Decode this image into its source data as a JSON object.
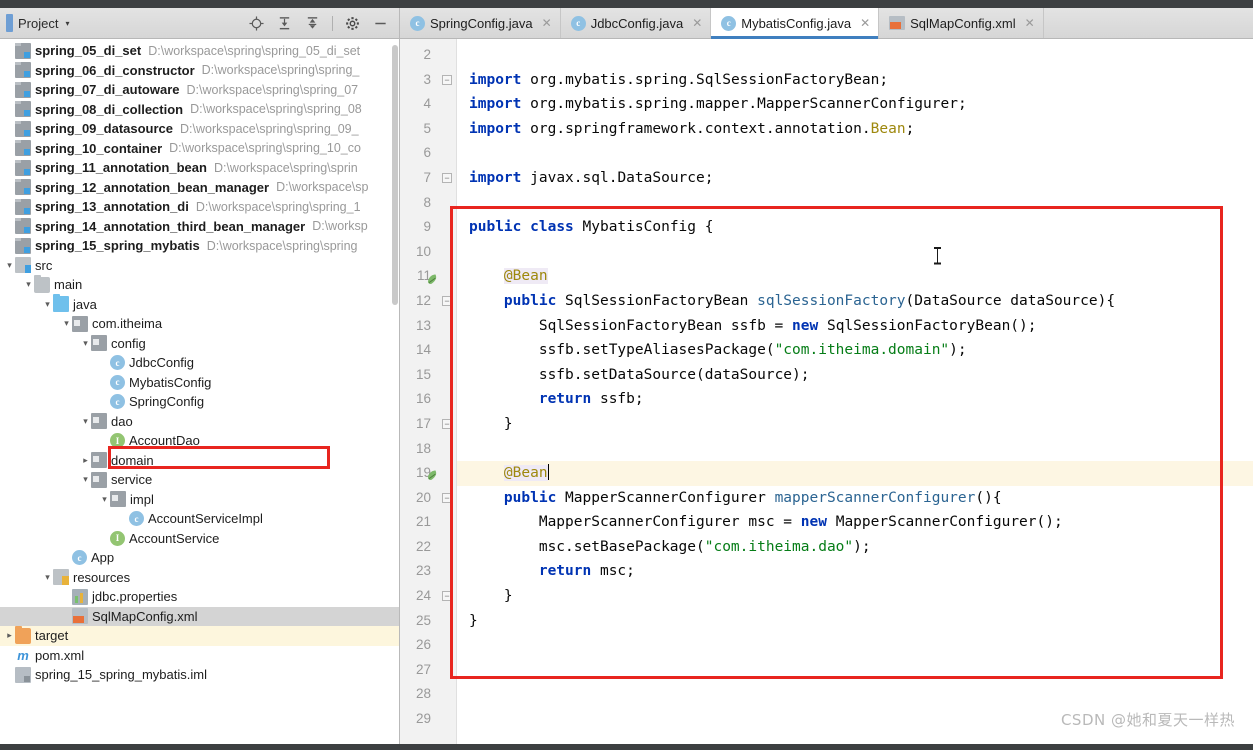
{
  "window": {
    "watermark": "CSDN @她和夏天一样热"
  },
  "project_panel": {
    "title": "Project",
    "caret": "▾",
    "tools": [
      {
        "name": "locate-icon",
        "glyph": "⊕"
      },
      {
        "name": "expand-all-icon",
        "glyph": "⇟"
      },
      {
        "name": "collapse-all-icon",
        "glyph": "⇞"
      },
      {
        "name": "settings-gear-icon",
        "glyph": "✿"
      },
      {
        "name": "hide-icon",
        "glyph": "—"
      }
    ],
    "modules": [
      {
        "name": "spring_05_di_set",
        "path": "D:\\workspace\\spring\\spring_05_di_set"
      },
      {
        "name": "spring_06_di_constructor",
        "path": "D:\\workspace\\spring\\spring_"
      },
      {
        "name": "spring_07_di_autoware",
        "path": "D:\\workspace\\spring\\spring_07"
      },
      {
        "name": "spring_08_di_collection",
        "path": "D:\\workspace\\spring\\spring_08"
      },
      {
        "name": "spring_09_datasource",
        "path": "D:\\workspace\\spring\\spring_09_"
      },
      {
        "name": "spring_10_container",
        "path": "D:\\workspace\\spring\\spring_10_co"
      },
      {
        "name": "spring_11_annotation_bean",
        "path": "D:\\workspace\\spring\\sprin"
      },
      {
        "name": "spring_12_annotation_bean_manager",
        "path": "D:\\workspace\\sp"
      },
      {
        "name": "spring_13_annotation_di",
        "path": "D:\\workspace\\spring\\spring_1"
      },
      {
        "name": "spring_14_annotation_third_bean_manager",
        "path": "D:\\worksp"
      },
      {
        "name": "spring_15_spring_mybatis",
        "path": "D:\\workspace\\spring\\spring"
      }
    ],
    "tree_nodes": [
      {
        "label": "src",
        "icon": "folder-src",
        "depth": 1,
        "arrow": "▾"
      },
      {
        "label": "main",
        "icon": "folder",
        "depth": 2,
        "arrow": "▾"
      },
      {
        "label": "java",
        "icon": "folder-java",
        "depth": 3,
        "arrow": "▾"
      },
      {
        "label": "com.itheima",
        "icon": "package",
        "depth": 4,
        "arrow": "▾"
      },
      {
        "label": "config",
        "icon": "package",
        "depth": 5,
        "arrow": "▾"
      },
      {
        "label": "JdbcConfig",
        "icon": "class",
        "depth": 6,
        "arrow": ""
      },
      {
        "label": "MybatisConfig",
        "icon": "class",
        "depth": 6,
        "arrow": "",
        "highlighted": true
      },
      {
        "label": "SpringConfig",
        "icon": "class",
        "depth": 6,
        "arrow": ""
      },
      {
        "label": "dao",
        "icon": "package",
        "depth": 5,
        "arrow": "▾"
      },
      {
        "label": "AccountDao",
        "icon": "interface",
        "depth": 6,
        "arrow": ""
      },
      {
        "label": "domain",
        "icon": "package",
        "depth": 5,
        "arrow": "▸"
      },
      {
        "label": "service",
        "icon": "package",
        "depth": 5,
        "arrow": "▾"
      },
      {
        "label": "impl",
        "icon": "package",
        "depth": 6,
        "arrow": "▾"
      },
      {
        "label": "AccountServiceImpl",
        "icon": "class",
        "depth": 7,
        "arrow": ""
      },
      {
        "label": "AccountService",
        "icon": "interface",
        "depth": 6,
        "arrow": ""
      },
      {
        "label": "App",
        "icon": "class-run",
        "depth": 4,
        "arrow": ""
      },
      {
        "label": "resources",
        "icon": "folder-res",
        "depth": 3,
        "arrow": "▾"
      },
      {
        "label": "jdbc.properties",
        "icon": "properties",
        "depth": 4,
        "arrow": ""
      },
      {
        "label": "SqlMapConfig.xml",
        "icon": "xml",
        "depth": 4,
        "arrow": "",
        "selected": true
      },
      {
        "label": "target",
        "icon": "folder-target",
        "depth": 1,
        "arrow": "▸",
        "yellow": true
      },
      {
        "label": "pom.xml",
        "icon": "maven",
        "depth": 1,
        "arrow": ""
      },
      {
        "label": "spring_15_spring_mybatis.iml",
        "icon": "iml",
        "depth": 1,
        "arrow": ""
      }
    ]
  },
  "editor": {
    "tabs": [
      {
        "label": "SpringConfig.java",
        "icon": "java-class-icon",
        "active": false,
        "close": "✕"
      },
      {
        "label": "JdbcConfig.java",
        "icon": "java-class-icon",
        "active": false,
        "close": "✕"
      },
      {
        "label": "MybatisConfig.java",
        "icon": "java-class-icon",
        "active": true,
        "close": "✕"
      },
      {
        "label": "SqlMapConfig.xml",
        "icon": "xml-file-icon",
        "active": false,
        "close": "✕"
      }
    ],
    "first_line_number": 2,
    "last_line_number": 29,
    "lines": [
      {
        "n": 2,
        "text": "",
        "fold": false
      },
      {
        "n": 3,
        "text": "import org.mybatis.spring.SqlSessionFactoryBean;",
        "fold": true
      },
      {
        "n": 4,
        "text": "import org.mybatis.spring.mapper.MapperScannerConfigurer;"
      },
      {
        "n": 5,
        "text": "import org.springframework.context.annotation.Bean;"
      },
      {
        "n": 6,
        "text": ""
      },
      {
        "n": 7,
        "text": "import javax.sql.DataSource;",
        "fold": true
      },
      {
        "n": 8,
        "text": ""
      },
      {
        "n": 9,
        "text": "public class MybatisConfig {"
      },
      {
        "n": 10,
        "text": ""
      },
      {
        "n": 11,
        "text": "    @Bean",
        "gutter_icon": "bean-icon"
      },
      {
        "n": 12,
        "text": "    public SqlSessionFactoryBean sqlSessionFactory(DataSource dataSource){",
        "fold": true
      },
      {
        "n": 13,
        "text": "        SqlSessionFactoryBean ssfb = new SqlSessionFactoryBean();"
      },
      {
        "n": 14,
        "text": "        ssfb.setTypeAliasesPackage(\"com.itheima.domain\");"
      },
      {
        "n": 15,
        "text": "        ssfb.setDataSource(dataSource);"
      },
      {
        "n": 16,
        "text": "        return ssfb;"
      },
      {
        "n": 17,
        "text": "    }",
        "fold": true
      },
      {
        "n": 18,
        "text": ""
      },
      {
        "n": 19,
        "text": "    @Bean",
        "gutter_icon": "bean-icon",
        "caret_line": true
      },
      {
        "n": 20,
        "text": "    public MapperScannerConfigurer mapperScannerConfigurer(){",
        "fold": true
      },
      {
        "n": 21,
        "text": "        MapperScannerConfigurer msc = new MapperScannerConfigurer();"
      },
      {
        "n": 22,
        "text": "        msc.setBasePackage(\"com.itheima.dao\");"
      },
      {
        "n": 23,
        "text": "        return msc;"
      },
      {
        "n": 24,
        "text": "    }",
        "fold": true
      },
      {
        "n": 25,
        "text": "}"
      },
      {
        "n": 26,
        "text": ""
      },
      {
        "n": 27,
        "text": ""
      },
      {
        "n": 28,
        "text": ""
      },
      {
        "n": 29,
        "text": ""
      }
    ]
  },
  "colors": {
    "highlight_red": "#e8251f",
    "keyword_blue": "#0033b3",
    "string_green": "#067d17",
    "method_blue": "#2b6492",
    "annotation_gold": "#9e880d",
    "tab_underline": "#3f7fbf",
    "selection_grey": "#d4d4d4"
  }
}
